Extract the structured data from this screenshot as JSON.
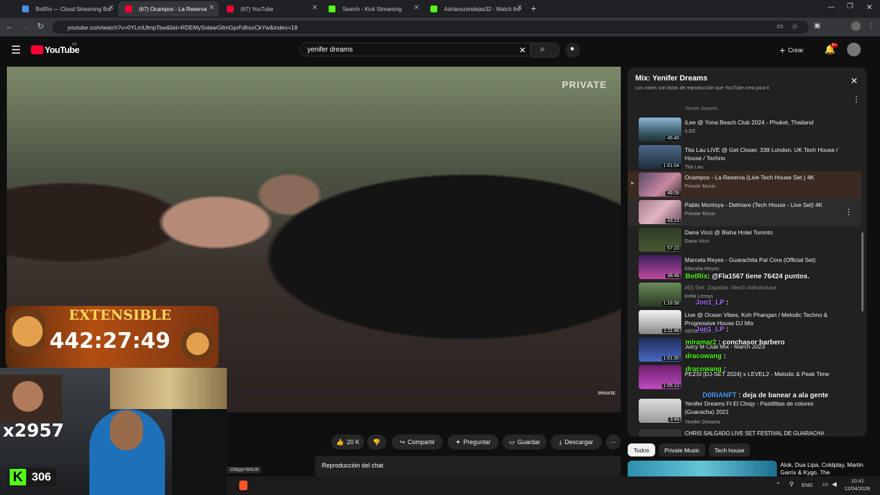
{
  "browser": {
    "tabs": [
      {
        "label": "BotRix — Cloud Streaming Bot",
        "color": "#4a90e2"
      },
      {
        "label": "(67) Ocampox - La Reserva",
        "color": "#ff0033"
      },
      {
        "label": "(67) YouTube",
        "color": "#ff0033"
      },
      {
        "label": "Search - Kick Streaming",
        "color": "#53fc18"
      },
      {
        "label": "Adrianozendejas32 - Watch the",
        "color": "#53fc18"
      }
    ],
    "new_tab": "+",
    "url": "youtube.com/watch?v=0YLmUlmpTsw&list=RDEMySolawGllmGprFdhsxCkYw&index=18"
  },
  "youtube": {
    "logo": "YouTube",
    "logo_region": "PE",
    "search_value": "yenifer dreams",
    "create_label": "Crear",
    "notif_badge": "9+"
  },
  "video": {
    "watermark": "PRIVATE",
    "watermark_small": "PRIVATE"
  },
  "overlay": {
    "ext_title": "EXTENSIBLE",
    "timer": "442:27:49",
    "cam_number": "x2957",
    "viewers": "306",
    "kick_letter": "K",
    "status_url": "19&pp=8AU8"
  },
  "actions": {
    "likes": "20 K",
    "share": "Compartir",
    "ask": "Preguntar",
    "save": "Guardar",
    "download": "Descargar",
    "chat_replay": "Reproducción del chat"
  },
  "playlist": {
    "title": "Mix: Yenifer Dreams",
    "subtitle": "Los mixes son listas de reproducción que YouTube crea para ti",
    "top_channel": "Yenifer Dreams",
    "items": [
      {
        "title": "iLee @ Yona Beach Club 2024 - Phuket, Thailand",
        "channel": "iLEE",
        "duration": "45:40"
      },
      {
        "title": "Tita Lau LIVE @ Get Closer, 338 London, UK Tech House / House / Techno",
        "channel": "Tita Lau",
        "duration": "1:01:04"
      },
      {
        "title": "Ocampox - La Reserva (Live Tech House Set ) 4K",
        "channel": "Private Music",
        "duration": "49:09"
      },
      {
        "title": "Pablo Montoya - Delmare (Tech House - Live Set) 4K",
        "channel": "Private Music",
        "duration": "43:23"
      },
      {
        "title": "Dana Vicci @ Bisha Hotel Toronto",
        "channel": "Dana Vicci",
        "duration": "57:23"
      },
      {
        "title": "Marcela Reyes - Guarachita Pal Cora (Official Set)",
        "channel": "Marcela Reyes",
        "duration": "38:46"
      },
      {
        "title": "#Dj Set: Zapallar. #tech #afrohouse",
        "channel": "Keila Lemus",
        "duration": "1:16:58"
      },
      {
        "title": "Live @ Ocean Vibes, Koh Phangan / Melodic Techno & Progressive House DJ Mix",
        "channel": "XENIA DIA",
        "duration": "1:11:46"
      },
      {
        "title": "Juicy M Club Mix - March 2023",
        "channel": "",
        "duration": "1:01:30"
      },
      {
        "title": "PEZSI [DJ-SET 2024] x LEVEL2 - Melodic & Peak Time",
        "channel": "",
        "duration": "1:05:13"
      },
      {
        "title": "Yenifer Dreams Ft El Cloqy - Pastillitas de colores (Guaracha) 2021",
        "channel": "Yenifer Dreams",
        "duration": "3:49"
      },
      {
        "title": "CHRIS SALGADO LIVE SET FESTIVAL DE GUARACHA",
        "channel": "",
        "duration": ""
      }
    ]
  },
  "chat": {
    "botrix_name": "BotRix",
    "botrix_msg": ": @Fla1567 tiene 76424 puntos.",
    "line1_name": "Jon1_LP",
    "line1_msg": " :",
    "line2_name": "Jon1_LP",
    "line2_msg": " :",
    "line3_name": "miramar2",
    "line3_msg": " : conchasor barbero",
    "line4_name": "dracowang",
    "line4_msg": " :",
    "line5_name": "dracowang",
    "line5_msg": " :",
    "line6_name": "D0RIANFT",
    "line6_msg": " : deja de banear a ala gente"
  },
  "chips": [
    "Todos",
    "Private Music",
    "Tech house"
  ],
  "recommend": {
    "title": "Alok, Dua Lipa, Coldplay, Martin Garrix & Kygo, The"
  },
  "taskbar": {
    "lang": "ENG",
    "time": "10:41",
    "date": "12/04/2026"
  }
}
